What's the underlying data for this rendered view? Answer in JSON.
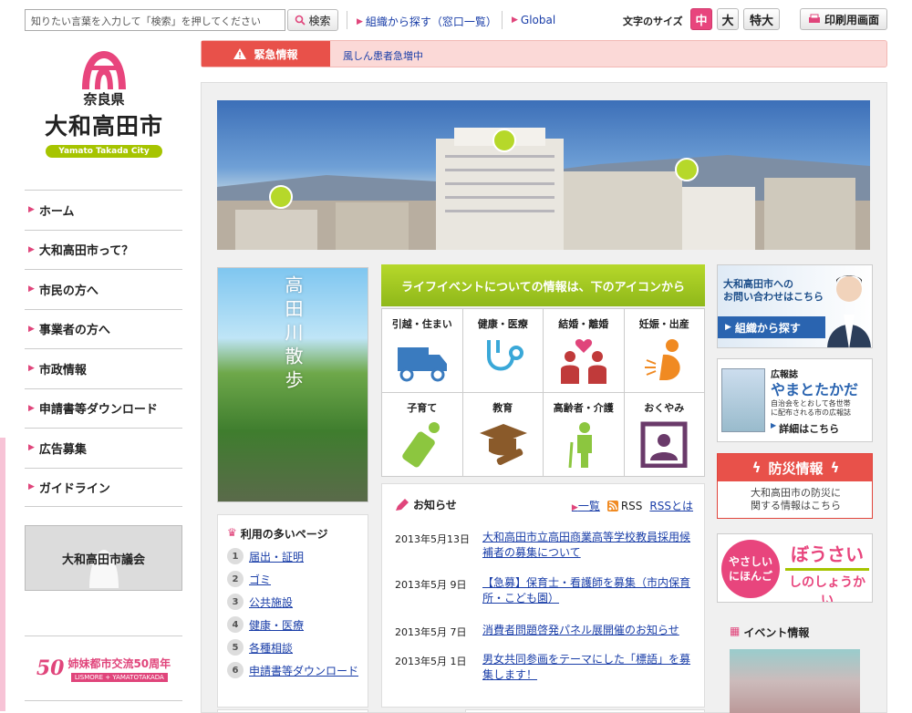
{
  "header": {
    "search_placeholder": "知りたい言葉を入力して「検索」を押してください",
    "search_button": "検索",
    "org_link": "組織から探す（窓口一覧）",
    "global_link": "Global",
    "font_size_label": "文字のサイズ",
    "font_sizes": [
      "中",
      "大",
      "特大"
    ],
    "print_button": "印刷用画面"
  },
  "logo": {
    "prefecture": "奈良県",
    "city": "大和高田市",
    "english": "Yamato Takada City"
  },
  "nav": {
    "items": [
      "ホーム",
      "大和高田市って？",
      "市民の方へ",
      "事業者の方へ",
      "市政情報",
      "申請書等ダウンロード",
      "広告募集",
      "ガイドライン"
    ]
  },
  "council": "大和高田市議会",
  "sister_city": {
    "title": "姉妹都市交流50周年",
    "sub": "LISMORE + YAMATOTAKADA"
  },
  "emergency": {
    "label": "緊急情報",
    "message": "風しん患者急増中"
  },
  "river_banner": "高田川散歩",
  "life_events": {
    "heading": "ライフイベントについての情報は、下のアイコンから",
    "items": [
      "引越・住まい",
      "健康・医療",
      "結婚・離婚",
      "妊娠・出産",
      "子育て",
      "教育",
      "高齢者・介護",
      "おくやみ"
    ]
  },
  "news": {
    "heading": "お知らせ",
    "list_link": "一覧",
    "rss": "RSS",
    "rss_about": "RSSとは",
    "items": [
      {
        "date": "2013年5月13日",
        "title": "大和高田市立高田商業高等学校教員採用候補者の募集について"
      },
      {
        "date": "2013年5月 9日",
        "title": "【急募】保育士・看護師を募集（市内保育所・こども園）"
      },
      {
        "date": "2013年5月 7日",
        "title": "消費者問題啓発パネル展開催のお知らせ"
      },
      {
        "date": "2013年5月 1日",
        "title": "男女共同参画をテーマにした「標語」を募集します！"
      }
    ]
  },
  "popular": {
    "heading": "利用の多いページ",
    "items": [
      "届出・証明",
      "ゴミ",
      "公共施設",
      "健康・医療",
      "各種相談",
      "申請書等ダウンロード"
    ]
  },
  "banners": {
    "inquiry_line1": "大和高田市への",
    "inquiry_line2": "お問い合わせはこちら",
    "inquiry_button": "組織から探す",
    "pr_small": "広報誌",
    "pr_title": "やまとたかだ",
    "pr_desc1": "自治会をとおして各世帯",
    "pr_desc2": "に配布される市の広報誌",
    "pr_more": "詳細はこちら",
    "disaster_title": "防災情報",
    "disaster_desc1": "大和高田市の防災に",
    "disaster_desc2": "関する情報はこちら",
    "easy_left1": "やさしい",
    "easy_left2": "にほんご",
    "easy_right1": "ぼうさい",
    "easy_right2": "しのしょうかい"
  },
  "events_heading": "イベント情報",
  "colors": {
    "accent_pink": "#e0457b",
    "accent_green": "#a6c400",
    "emergency_red": "#e8514a",
    "link_blue": "#1a3ea8"
  }
}
